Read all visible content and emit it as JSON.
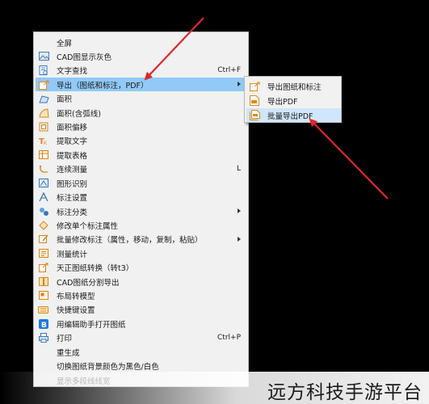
{
  "menu": {
    "items": [
      {
        "label": "全屏",
        "shortcut": "",
        "icon": "none",
        "submenu": false
      },
      {
        "label": "CAD图显示灰色",
        "shortcut": "",
        "icon": "image-gray-icon",
        "submenu": false
      },
      {
        "label": "文字查找",
        "shortcut": "Ctrl+F",
        "icon": "text-search-icon",
        "submenu": false
      },
      {
        "label": "导出（图纸和标注，PDF）",
        "shortcut": "",
        "icon": "export-icon",
        "submenu": true,
        "highlighted": true
      },
      {
        "label": "面积",
        "shortcut": "",
        "icon": "area-icon",
        "submenu": false
      },
      {
        "label": "面积(含弧线)",
        "shortcut": "",
        "icon": "area-arc-icon",
        "submenu": false
      },
      {
        "label": "面积偏移",
        "shortcut": "",
        "icon": "area-offset-icon",
        "submenu": false
      },
      {
        "label": "提取文字",
        "shortcut": "",
        "icon": "extract-text-icon",
        "submenu": false
      },
      {
        "label": "提取表格",
        "shortcut": "",
        "icon": "extract-table-icon",
        "submenu": false
      },
      {
        "label": "连续测量",
        "shortcut": "L",
        "icon": "continuous-measure-icon",
        "submenu": false
      },
      {
        "label": "图形识别",
        "shortcut": "",
        "icon": "shape-recognition-icon",
        "submenu": false
      },
      {
        "label": "标注设置",
        "shortcut": "",
        "icon": "annotation-settings-icon",
        "submenu": false
      },
      {
        "label": "标注分类",
        "shortcut": "",
        "icon": "annotation-category-icon",
        "submenu": true
      },
      {
        "label": "修改单个标注属性",
        "shortcut": "",
        "icon": "edit-annotation-icon",
        "submenu": false
      },
      {
        "label": "批量修改标注（属性，移动，复制，粘贴）",
        "shortcut": "",
        "icon": "batch-edit-icon",
        "submenu": true
      },
      {
        "label": "测量统计",
        "shortcut": "",
        "icon": "measure-stats-icon",
        "submenu": false
      },
      {
        "label": "天正图纸转换（转t3）",
        "shortcut": "",
        "icon": "convert-icon",
        "submenu": false
      },
      {
        "label": "CAD图纸分割导出",
        "shortcut": "",
        "icon": "split-export-icon",
        "submenu": false
      },
      {
        "label": "布局转模型",
        "shortcut": "",
        "icon": "layout-model-icon",
        "submenu": false
      },
      {
        "label": "快捷键设置",
        "shortcut": "",
        "icon": "keyboard-icon",
        "submenu": false
      },
      {
        "label": "用编辑助手打开图纸",
        "shortcut": "",
        "icon": "editor-open-icon",
        "submenu": false
      },
      {
        "label": "打印",
        "shortcut": "Ctrl+P",
        "icon": "print-icon",
        "submenu": false
      },
      {
        "label": "重生成",
        "shortcut": "",
        "icon": "none",
        "submenu": false
      },
      {
        "label": "切换图纸背景颜色为黑色/白色",
        "shortcut": "",
        "icon": "none",
        "submenu": false
      },
      {
        "label": "显示多段线线宽",
        "shortcut": "",
        "icon": "none",
        "submenu": false,
        "disabled": true
      }
    ]
  },
  "submenu": {
    "items": [
      {
        "label": "导出图纸和标注",
        "icon": "export-drawing-icon"
      },
      {
        "label": "导出PDF",
        "icon": "pdf-icon"
      },
      {
        "label": "批量导出PDF",
        "icon": "batch-pdf-icon",
        "highlighted": true
      }
    ]
  },
  "watermark": "远方科技手游平台",
  "colors": {
    "background": "#000000",
    "menu_bg": "#f1f1f1",
    "highlight": "#91c9f7",
    "arrow": "#e0262b"
  }
}
